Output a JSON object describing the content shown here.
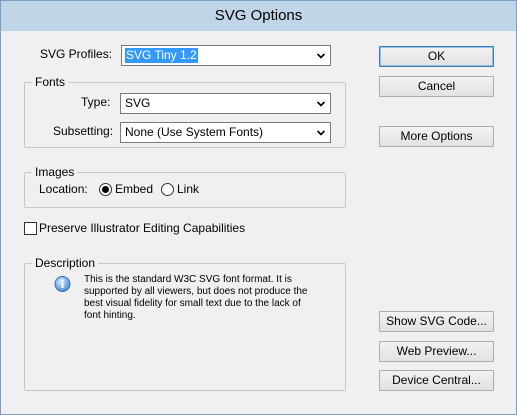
{
  "window": {
    "title": "SVG Options"
  },
  "svg_profiles": {
    "label": "SVG Profiles:",
    "value": "SVG Tiny 1.2"
  },
  "fonts": {
    "legend": "Fonts",
    "type_label": "Type:",
    "type_value": "SVG",
    "subsetting_label": "Subsetting:",
    "subsetting_value": "None (Use System Fonts)"
  },
  "images": {
    "legend": "Images",
    "location_label": "Location:",
    "embed_label": "Embed",
    "link_label": "Link",
    "selected": "Embed"
  },
  "preserve": {
    "label": "Preserve Illustrator Editing Capabilities",
    "checked": false
  },
  "description": {
    "legend": "Description",
    "text": "This is the standard W3C SVG font format.  It is\nsupported by all viewers, but does not produce the\nbest visual fidelity for small text due to the lack of\nfont hinting."
  },
  "buttons": {
    "ok": "OK",
    "cancel": "Cancel",
    "more_options": "More Options",
    "show_svg_code": "Show SVG Code...",
    "web_preview": "Web Preview...",
    "device_central": "Device Central..."
  },
  "icons": {
    "dropdown": "chevron-down-icon",
    "info": "info-icon"
  },
  "colors": {
    "title_bar": "#c1d5e9",
    "selection": "#3399ff",
    "window_border": "#7a9fc3"
  }
}
